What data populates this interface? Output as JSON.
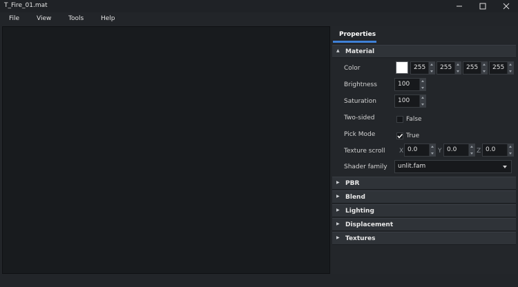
{
  "window": {
    "title": "T_Fire_01.mat",
    "minimize_icon": "minimize-icon",
    "maximize_icon": "maximize-icon",
    "close_icon": "close-icon"
  },
  "menu": [
    "File",
    "View",
    "Tools",
    "Help"
  ],
  "panel": {
    "tab": "Properties",
    "accent": "#3f81d8",
    "material": {
      "title": "Material",
      "color": {
        "label": "Color",
        "swatch": "#ffffff",
        "r": "255",
        "g": "255",
        "b": "255",
        "a": "255"
      },
      "brightness": {
        "label": "Brightness",
        "value": "100"
      },
      "saturation": {
        "label": "Saturation",
        "value": "100"
      },
      "two_sided": {
        "label": "Two-sided",
        "value": "False",
        "checked": false
      },
      "pick_mode": {
        "label": "Pick Mode",
        "value": "True",
        "checked": true
      },
      "texture_scroll": {
        "label": "Texture scroll",
        "x_label": "X",
        "x": "0.0",
        "y_label": "Y",
        "y": "0.0",
        "z_label": "Z",
        "z": "0.0"
      },
      "shader_family": {
        "label": "Shader family",
        "value": "unlit.fam"
      }
    },
    "sections": [
      "PBR",
      "Blend",
      "Lighting",
      "Displacement",
      "Textures"
    ]
  }
}
